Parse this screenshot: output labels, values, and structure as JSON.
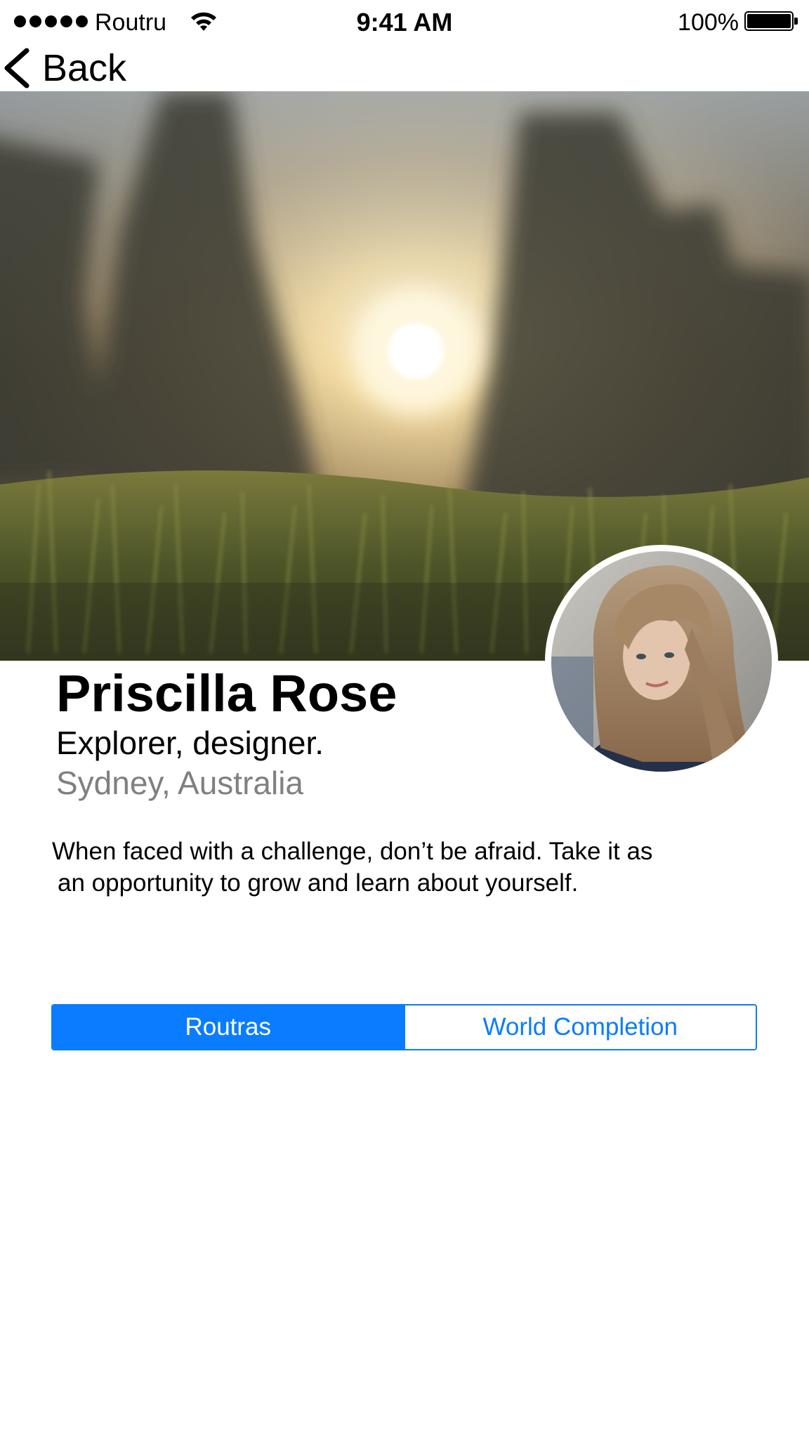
{
  "status_bar": {
    "carrier": "Routru",
    "time": "9:41 AM",
    "battery_percent": "100%",
    "battery_level": 1.0,
    "signal_bars": 5,
    "icons": [
      "signal-dots-icon",
      "wifi-icon",
      "battery-icon"
    ]
  },
  "nav": {
    "back_label": "Back",
    "back_icon": "chevron-left-icon"
  },
  "profile": {
    "name": "Priscilla Rose",
    "tagline": "Explorer, designer.",
    "location": "Sydney, Australia",
    "bio_line_1": "When faced with a challenge, don’t be afraid. Take it as",
    "bio_line_2": "an opportunity to grow and learn about yourself."
  },
  "segments": {
    "items": [
      {
        "label": "Routras",
        "selected": true
      },
      {
        "label": "World Completion",
        "selected": false
      }
    ]
  },
  "colors": {
    "accent": "#0A7CFF",
    "secondary_text": "#808080",
    "background": "#FFFFFF"
  }
}
